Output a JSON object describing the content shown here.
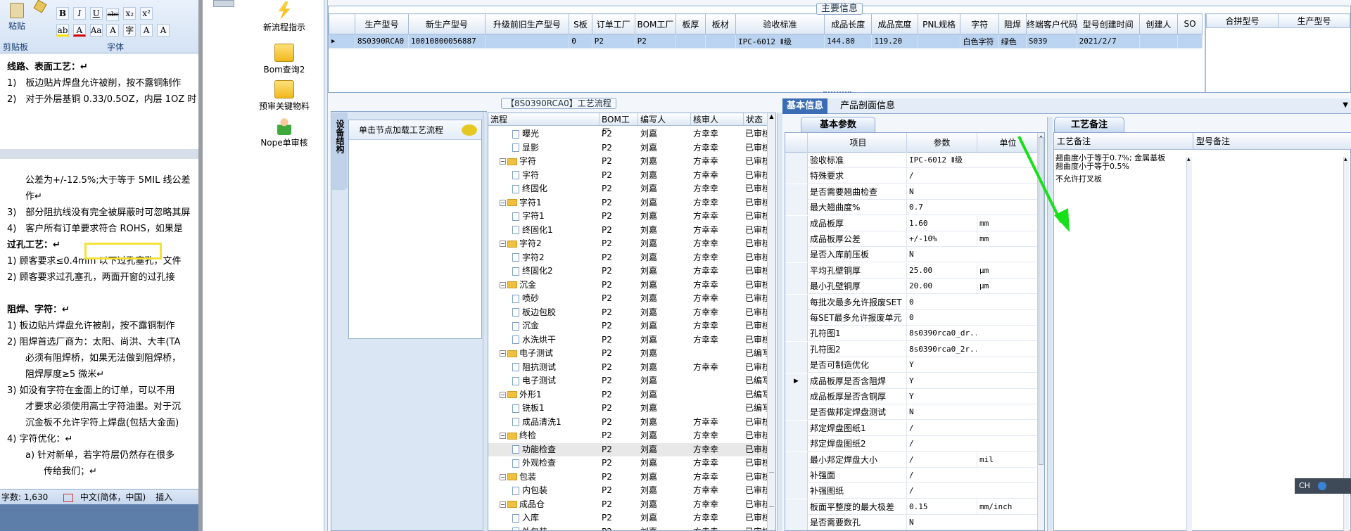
{
  "word": {
    "ribbon": {
      "paste": "粘贴",
      "clipboard": "剪贴板",
      "font_group": "字体",
      "format_btns": [
        "B",
        "I",
        "U",
        "abc",
        "x₂",
        "x²"
      ]
    },
    "doc_lines": [
      {
        "text": "线路、表面工艺：↵",
        "bold": true
      },
      {
        "text": "1)　板边贴片焊盘允许被削，按不露铜制作",
        "bold": false
      },
      {
        "text": "2)　对于外层基铜 0.33/0.5OZ，内层 1OZ 时",
        "bold": false
      },
      {
        "text": "",
        "bold": false
      },
      {
        "text": "",
        "bold": false
      },
      {
        "text": "",
        "bold": false
      },
      {
        "text": "",
        "bold": false
      },
      {
        "text": "　　公差为+/-12.5%;大于等于 5MIL 线公差",
        "bold": false
      },
      {
        "text": "　　作↵",
        "bold": false
      },
      {
        "text": "3)　部分阻抗线没有完全被屏蔽时可忽略其屏",
        "bold": false
      },
      {
        "text": "4)　客户所有订单要求符合 ROHS，如果是",
        "bold": false
      },
      {
        "text": "过孔工艺：↵",
        "bold": true
      },
      {
        "text": " 1) 顾客要求≤0.4mm 以下过孔塞孔，文件",
        "bold": false
      },
      {
        "text": " 2) 顾客要求过孔塞孔，两面开窗的过孔接",
        "bold": false
      },
      {
        "text": "",
        "bold": false
      },
      {
        "text": "阻焊、字符：↵",
        "bold": true
      },
      {
        "text": " 1) 板边贴片焊盘允许被削，按不露铜制作",
        "bold": false
      },
      {
        "text": " 2) 阻焊首选厂商为：太阳、尚洪、大丰(TA",
        "bold": false
      },
      {
        "text": "　　必须有阻焊桥，如果无法做到阻焊桥，",
        "bold": false
      },
      {
        "text": "　　阻焊厚度≥5 微米↵",
        "bold": false
      },
      {
        "text": " 3) 如没有字符在金面上的订单，可以不用",
        "bold": false
      },
      {
        "text": "　　才要求必须使用高士字符油墨。对于沉",
        "bold": false
      },
      {
        "text": "　　沉金板不允许字符上焊盘(包括大金面)",
        "bold": false
      },
      {
        "text": " 4) 字符优化：↵",
        "bold": false
      },
      {
        "text": "　　a) 针对新单，若字符层仍然存在很多",
        "bold": false
      },
      {
        "text": "　　　　传给我们；↵",
        "bold": false
      }
    ],
    "status": {
      "word_count": "字数: 1,630",
      "language": "中文(简体，中国)",
      "mode": "插入"
    }
  },
  "nav": {
    "items": [
      {
        "label": "新流程指示",
        "icon": "lightning-icon"
      },
      {
        "label": "Bom查询2",
        "icon": "folder-open-icon"
      },
      {
        "label": "预审关键物料",
        "icon": "folder-open-icon"
      },
      {
        "label": "Nope单审核",
        "icon": "user-check-icon"
      }
    ]
  },
  "main_info": {
    "group_title": "主要信息",
    "columns": [
      "生产型号",
      "新生产型号",
      "升级前旧生产型号",
      "S板",
      "订单工厂",
      "BOM工厂",
      "板厚",
      "板材",
      "验收标准",
      "成品长度",
      "成品宽度",
      "PNL规格",
      "字符",
      "阻焊",
      "终端客户代码",
      "型号创建时间",
      "创建人",
      "SO"
    ],
    "row": [
      "8S0390RCA0",
      "10010800056887",
      "",
      "0",
      "P2",
      "P2",
      "",
      "",
      "IPC-6012 Ⅱ级",
      "144.80",
      "119.20",
      "",
      "白色字符",
      "绿色",
      "S039",
      "2021/2/7",
      "",
      ""
    ],
    "side_columns": [
      "合拼型号",
      "生产型号"
    ]
  },
  "process": {
    "title": "【8S0390RCA0】工艺流程",
    "side_tab": "设备结构",
    "load_button": "单击节点加载工艺流程",
    "columns": [
      "流程",
      "BOM工厂",
      "编写人",
      "核审人",
      "状态"
    ],
    "rows": [
      {
        "level": 2,
        "type": "doc",
        "name": "曝光",
        "bom": "P2",
        "writer": "刘嘉",
        "reviewer": "方幸幸",
        "status": "已审核"
      },
      {
        "level": 2,
        "type": "doc",
        "name": "显影",
        "bom": "P2",
        "writer": "刘嘉",
        "reviewer": "方幸幸",
        "status": "已审核"
      },
      {
        "level": 1,
        "type": "folder",
        "name": "字符",
        "bom": "P2",
        "writer": "刘嘉",
        "reviewer": "方幸幸",
        "status": "已审核"
      },
      {
        "level": 2,
        "type": "doc",
        "name": "字符",
        "bom": "P2",
        "writer": "刘嘉",
        "reviewer": "方幸幸",
        "status": "已审核"
      },
      {
        "level": 2,
        "type": "doc",
        "name": "终固化",
        "bom": "P2",
        "writer": "刘嘉",
        "reviewer": "方幸幸",
        "status": "已审核"
      },
      {
        "level": 1,
        "type": "folder",
        "name": "字符1",
        "bom": "P2",
        "writer": "刘嘉",
        "reviewer": "方幸幸",
        "status": "已审核"
      },
      {
        "level": 2,
        "type": "doc",
        "name": "字符1",
        "bom": "P2",
        "writer": "刘嘉",
        "reviewer": "方幸幸",
        "status": "已审核"
      },
      {
        "level": 2,
        "type": "doc",
        "name": "终固化1",
        "bom": "P2",
        "writer": "刘嘉",
        "reviewer": "方幸幸",
        "status": "已审核"
      },
      {
        "level": 1,
        "type": "folder",
        "name": "字符2",
        "bom": "P2",
        "writer": "刘嘉",
        "reviewer": "方幸幸",
        "status": "已审核"
      },
      {
        "level": 2,
        "type": "doc",
        "name": "字符2",
        "bom": "P2",
        "writer": "刘嘉",
        "reviewer": "方幸幸",
        "status": "已审核"
      },
      {
        "level": 2,
        "type": "doc",
        "name": "终固化2",
        "bom": "P2",
        "writer": "刘嘉",
        "reviewer": "方幸幸",
        "status": "已审核"
      },
      {
        "level": 1,
        "type": "folder",
        "name": "沉金",
        "bom": "P2",
        "writer": "刘嘉",
        "reviewer": "方幸幸",
        "status": "已审核"
      },
      {
        "level": 2,
        "type": "doc",
        "name": "喷砂",
        "bom": "P2",
        "writer": "刘嘉",
        "reviewer": "方幸幸",
        "status": "已审核"
      },
      {
        "level": 2,
        "type": "doc",
        "name": "板边包胶",
        "bom": "P2",
        "writer": "刘嘉",
        "reviewer": "方幸幸",
        "status": "已审核"
      },
      {
        "level": 2,
        "type": "doc",
        "name": "沉金",
        "bom": "P2",
        "writer": "刘嘉",
        "reviewer": "方幸幸",
        "status": "已审核"
      },
      {
        "level": 2,
        "type": "doc",
        "name": "水洗烘干",
        "bom": "P2",
        "writer": "刘嘉",
        "reviewer": "方幸幸",
        "status": "已审核"
      },
      {
        "level": 1,
        "type": "folder",
        "name": "电子测试",
        "bom": "P2",
        "writer": "刘嘉",
        "reviewer": "",
        "status": "已编写"
      },
      {
        "level": 2,
        "type": "doc",
        "name": "阻抗测试",
        "bom": "P2",
        "writer": "刘嘉",
        "reviewer": "方幸幸",
        "status": "已审核"
      },
      {
        "level": 2,
        "type": "doc",
        "name": "电子测试",
        "bom": "P2",
        "writer": "刘嘉",
        "reviewer": "",
        "status": "已编写"
      },
      {
        "level": 1,
        "type": "folder",
        "name": "外形1",
        "bom": "P2",
        "writer": "刘嘉",
        "reviewer": "",
        "status": "已编写"
      },
      {
        "level": 2,
        "type": "doc",
        "name": "铣板1",
        "bom": "P2",
        "writer": "刘嘉",
        "reviewer": "",
        "status": "已编写"
      },
      {
        "level": 2,
        "type": "doc",
        "name": "成品清洗1",
        "bom": "P2",
        "writer": "刘嘉",
        "reviewer": "方幸幸",
        "status": "已审核"
      },
      {
        "level": 1,
        "type": "folder",
        "name": "终检",
        "bom": "P2",
        "writer": "刘嘉",
        "reviewer": "方幸幸",
        "status": "已审核"
      },
      {
        "level": 2,
        "type": "doc",
        "name": "功能检查",
        "bom": "P2",
        "writer": "刘嘉",
        "reviewer": "方幸幸",
        "status": "已审核"
      },
      {
        "level": 2,
        "type": "doc",
        "name": "外观检查",
        "bom": "P2",
        "writer": "刘嘉",
        "reviewer": "方幸幸",
        "status": "已审核"
      },
      {
        "level": 1,
        "type": "folder",
        "name": "包装",
        "bom": "P2",
        "writer": "刘嘉",
        "reviewer": "方幸幸",
        "status": "已审核"
      },
      {
        "level": 2,
        "type": "doc",
        "name": "内包装",
        "bom": "P2",
        "writer": "刘嘉",
        "reviewer": "方幸幸",
        "status": "已审核"
      },
      {
        "level": 1,
        "type": "folder",
        "name": "成品仓",
        "bom": "P2",
        "writer": "刘嘉",
        "reviewer": "方幸幸",
        "status": "已审核"
      },
      {
        "level": 2,
        "type": "doc",
        "name": "入库",
        "bom": "P2",
        "writer": "刘嘉",
        "reviewer": "方幸幸",
        "status": "已审核"
      },
      {
        "level": 2,
        "type": "doc",
        "name": "外包装",
        "bom": "P2",
        "writer": "刘嘉",
        "reviewer": "方幸幸",
        "status": "已审核"
      }
    ]
  },
  "basic": {
    "tabs": [
      "基本信息",
      "产品剖面信息"
    ],
    "subtab": "基本参数",
    "columns": [
      "项目",
      "参数",
      "单位"
    ],
    "rows": [
      {
        "item": "验收标准",
        "param": "IPC-6012 Ⅱ级",
        "unit": ""
      },
      {
        "item": "特殊要求",
        "param": "/",
        "unit": ""
      },
      {
        "item": "是否需要翘曲检查",
        "param": "N",
        "unit": ""
      },
      {
        "item": "最大翘曲度%",
        "param": "0.7",
        "unit": ""
      },
      {
        "item": "成品板厚",
        "param": "1.60",
        "unit": "mm"
      },
      {
        "item": "成品板厚公差",
        "param": "+/-10%",
        "unit": "mm"
      },
      {
        "item": "是否入库前压板",
        "param": "N",
        "unit": ""
      },
      {
        "item": "平均孔壁铜厚",
        "param": "25.00",
        "unit": "μm"
      },
      {
        "item": "最小孔壁铜厚",
        "param": "20.00",
        "unit": "μm"
      },
      {
        "item": "每批次最多允许报废SET",
        "param": "0",
        "unit": ""
      },
      {
        "item": "每SET最多允许报废单元",
        "param": "0",
        "unit": ""
      },
      {
        "item": "孔符图1",
        "param": "8s0390rca0_dr...",
        "unit": ""
      },
      {
        "item": "孔符图2",
        "param": "8s0390rca0_2r...",
        "unit": ""
      },
      {
        "item": "是否可制造优化",
        "param": "Y",
        "unit": ""
      },
      {
        "item": "成品板厚是否含阻焊",
        "param": "Y",
        "unit": ""
      },
      {
        "item": "成品板厚是否含铜厚",
        "param": "Y",
        "unit": ""
      },
      {
        "item": "是否做邦定焊盘测试",
        "param": "N",
        "unit": ""
      },
      {
        "item": "邦定焊盘图纸1",
        "param": "/",
        "unit": ""
      },
      {
        "item": "邦定焊盘图纸2",
        "param": "/",
        "unit": ""
      },
      {
        "item": "最小邦定焊盘大小",
        "param": "/",
        "unit": "mil"
      },
      {
        "item": "补强面",
        "param": "/",
        "unit": ""
      },
      {
        "item": "补强图纸",
        "param": "/",
        "unit": ""
      },
      {
        "item": "板面平整度的最大极差",
        "param": "0.15",
        "unit": "mm/inch"
      },
      {
        "item": "是否需要数孔",
        "param": "N",
        "unit": ""
      }
    ],
    "selected_index": 14
  },
  "notes": {
    "title": "工艺备注",
    "col1": "工艺备注",
    "col2": "型号备注",
    "lines": [
      "翘曲度小于等于0.7%; 金属基板",
      "翘曲度小于等于0.5%",
      "不允许打叉板"
    ]
  },
  "ime": {
    "label": "CH"
  },
  "colors": {
    "accent": "#3a6db4",
    "selection": "#bad3f0",
    "annotation_arrow": "#18e018",
    "highlight_box": "#f2e23a"
  }
}
